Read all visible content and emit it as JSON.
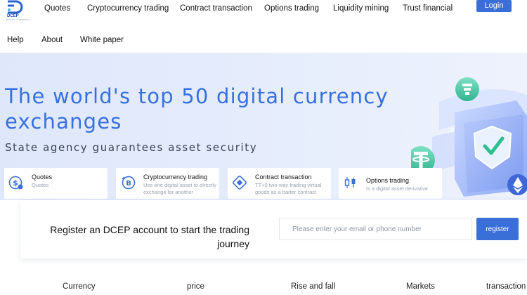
{
  "brand": {
    "name": "DCEP",
    "tagline": "DIGITAL CURRENCY"
  },
  "nav": {
    "row1": [
      "Quotes",
      "Cryptocurrency trading",
      "Contract transaction",
      "Options trading",
      "Liquidity mining",
      "Trust financial"
    ],
    "row2": [
      "Help",
      "About",
      "White paper"
    ],
    "login": "Login"
  },
  "hero": {
    "title": "The world's top 50 digital currency exchanges",
    "subtitle": "State agency guarantees asset security",
    "art_icons": [
      "stack-coin-icon",
      "tether-coin-icon",
      "shield-check-icon",
      "ethereum-coin-icon"
    ]
  },
  "features": [
    {
      "title": "Quotes",
      "desc": "Quotes",
      "icon": "dollar-coin-icon"
    },
    {
      "title": "Cryptocurrency trading",
      "desc": "Use one digital asset to directly exchange for another",
      "icon": "bitcoin-icon"
    },
    {
      "title": "Contract transaction",
      "desc": "TT+0 two-way trading virtual goods as a barter contract",
      "icon": "diamond-contract-icon"
    },
    {
      "title": "Options trading",
      "desc": "Is a digital asset derivative",
      "icon": "candlestick-icon"
    }
  ],
  "register": {
    "text": "Register an DCEP account to start the trading journey",
    "placeholder": "Please enter your email or phone number",
    "button": "register"
  },
  "table": {
    "headers": [
      "Currency",
      "price",
      "Rise and fall",
      "Markets",
      "transaction"
    ]
  },
  "colors": {
    "accent": "#3b6fd8",
    "title": "#3771e0",
    "hero_bg": "#e2e9fb"
  }
}
